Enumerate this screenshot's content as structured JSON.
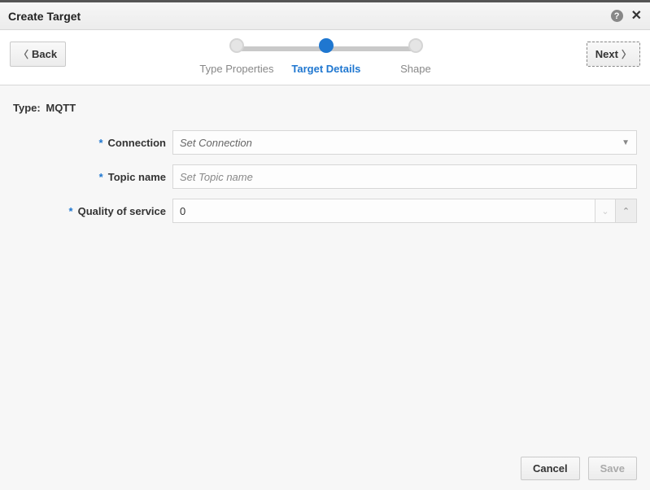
{
  "title": "Create Target",
  "nav": {
    "back": "Back",
    "next": "Next"
  },
  "steps": {
    "a": "Type Properties",
    "b": "Target Details",
    "c": "Shape"
  },
  "form": {
    "type_label": "Type",
    "type_value": "MQTT",
    "connection": {
      "label": "Connection",
      "placeholder": "Set Connection"
    },
    "topic": {
      "label": "Topic name",
      "placeholder": "Set Topic name"
    },
    "qos": {
      "label": "Quality of service",
      "value": "0"
    }
  },
  "footer": {
    "cancel": "Cancel",
    "save": "Save"
  }
}
